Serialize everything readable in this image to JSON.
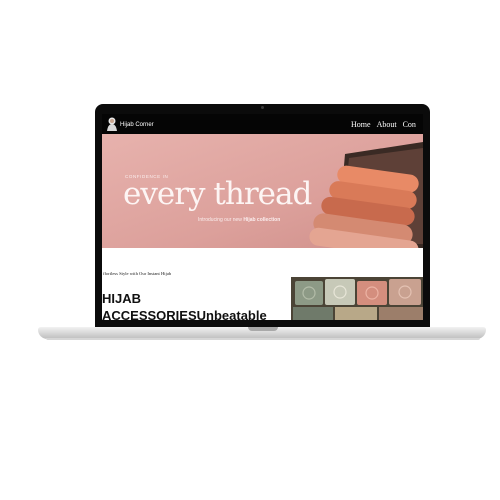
{
  "nav": {
    "brand": "Hijab Corner",
    "links": [
      "Home",
      "About",
      "Con"
    ]
  },
  "hero": {
    "kicker": "CONFIDENCE IN",
    "title": "every thread",
    "subtitle_pre": "Introducing our new",
    "subtitle_bold": "Hijab collection"
  },
  "content": {
    "tagline": "ffortless Style with Our Instant Hijab",
    "heading_line1": "HIJAB",
    "heading_line2": "ACCESSORIESUnbeatable"
  },
  "colors": {
    "hero_bg": "#dfa4a0",
    "nav_bg": "#050505"
  }
}
